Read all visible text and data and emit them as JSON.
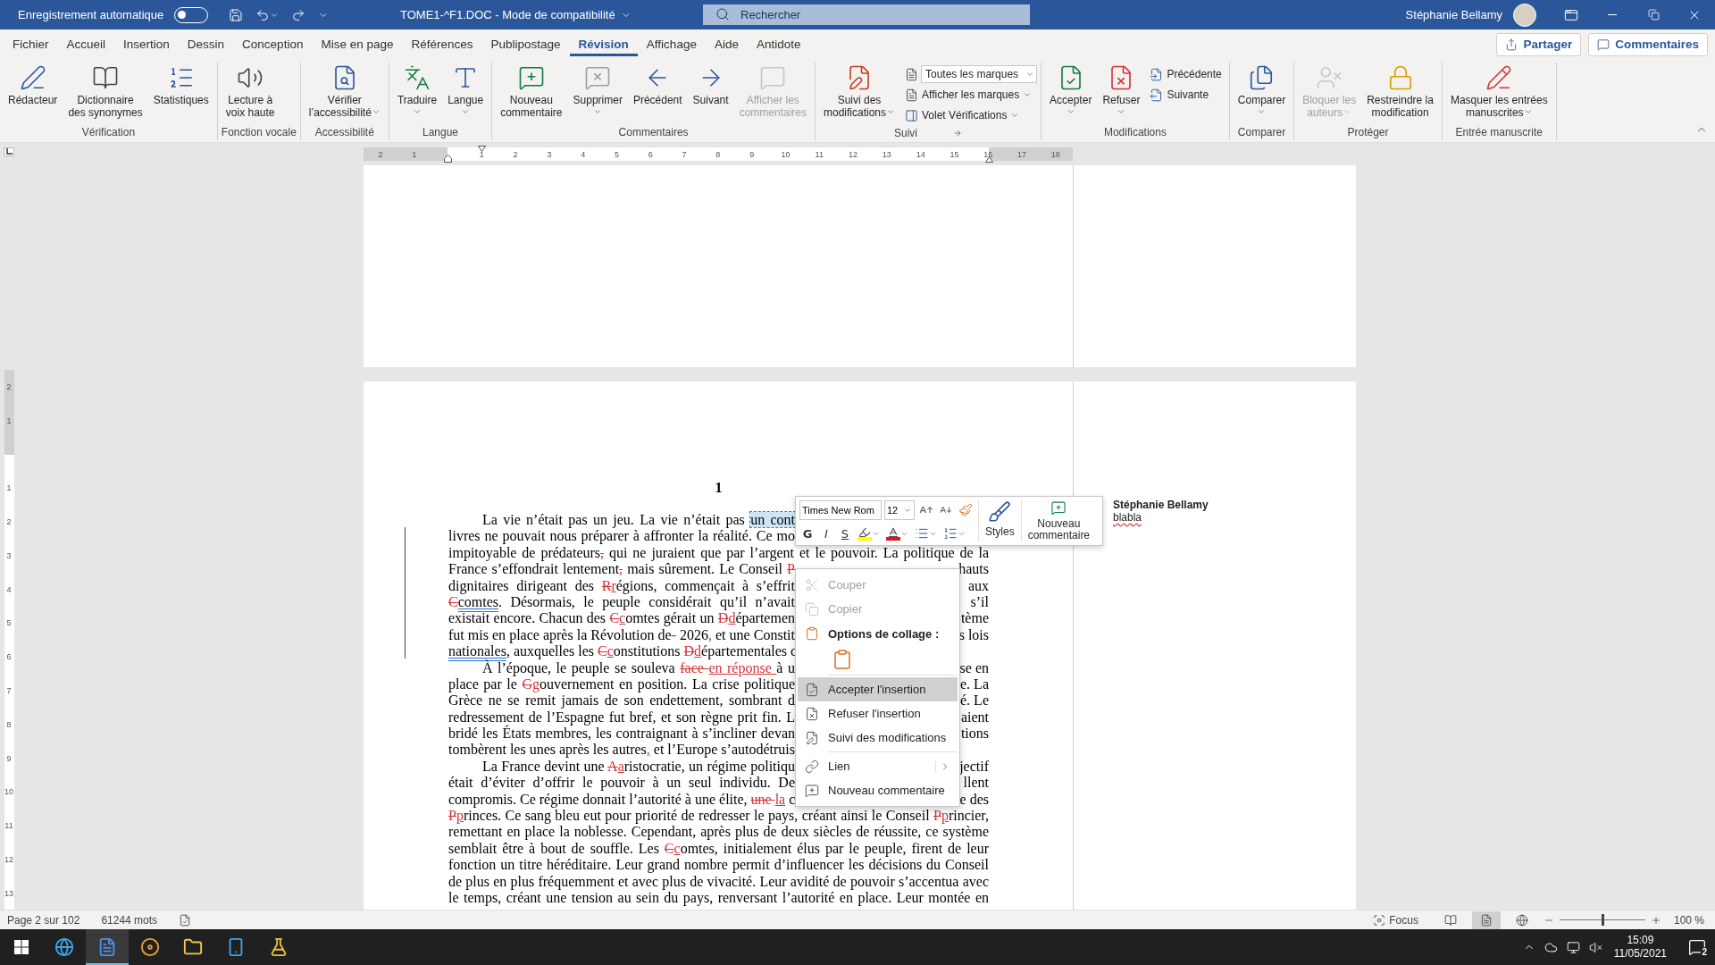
{
  "title_bar": {
    "autosave_label": "Enregistrement automatique",
    "autosave_on": false,
    "title": "TOME1-^F1.DOC - Mode de compatibilité",
    "search_placeholder": "Rechercher",
    "user": "Stéphanie Bellamy"
  },
  "menu_tabs": [
    {
      "label": "Fichier",
      "selected": false
    },
    {
      "label": "Accueil",
      "selected": false
    },
    {
      "label": "Insertion",
      "selected": false
    },
    {
      "label": "Dessin",
      "selected": false
    },
    {
      "label": "Conception",
      "selected": false
    },
    {
      "label": "Mise en page",
      "selected": false
    },
    {
      "label": "Références",
      "selected": false
    },
    {
      "label": "Publipostage",
      "selected": false
    },
    {
      "label": "Révision",
      "selected": true
    },
    {
      "label": "Affichage",
      "selected": false
    },
    {
      "label": "Aide",
      "selected": false
    },
    {
      "label": "Antidote",
      "selected": false
    }
  ],
  "share_button": "Partager",
  "comments_button": "Commentaires",
  "ribbon": [
    {
      "label": "Vérification",
      "items": [
        {
          "kind": "large",
          "label": "Rédacteur",
          "disabled": false
        },
        {
          "kind": "large",
          "label": "Dictionnaire\ndes synonymes",
          "disabled": false
        },
        {
          "kind": "large",
          "label": "Statistiques",
          "disabled": false
        }
      ]
    },
    {
      "label": "Fonction vocale",
      "items": [
        {
          "kind": "large",
          "label": "Lecture à\nvoix haute",
          "disabled": false
        }
      ]
    },
    {
      "label": "Accessibilité",
      "items": [
        {
          "kind": "large",
          "label": "Vérifier\nl’accessibilité",
          "dropdown": true,
          "disabled": false
        }
      ]
    },
    {
      "label": "Langue",
      "items": [
        {
          "kind": "large",
          "label": "Traduire",
          "dropdown": true,
          "disabled": false
        },
        {
          "kind": "large",
          "label": "Langue",
          "dropdown": true,
          "disabled": false
        }
      ]
    },
    {
      "label": "Commentaires",
      "items": [
        {
          "kind": "large",
          "label": "Nouveau\ncommentaire",
          "disabled": false
        },
        {
          "kind": "large",
          "label": "Supprimer",
          "dropdown": true,
          "disabled": false
        },
        {
          "kind": "large",
          "label": "Précédent",
          "disabled": false
        },
        {
          "kind": "large",
          "label": "Suivant",
          "disabled": false
        },
        {
          "kind": "large",
          "label": "Afficher les\ncommentaires",
          "disabled": true
        }
      ]
    },
    {
      "label": "Suivi",
      "launcher": true,
      "items": [
        {
          "kind": "large",
          "label": "Suivi des\nmodifications",
          "dropdown": true,
          "disabled": false
        },
        {
          "kind": "select",
          "label": "Toutes les marques",
          "disabled": false
        },
        {
          "kind": "small",
          "label": "Afficher les marques",
          "dropdown": true,
          "disabled": false
        },
        {
          "kind": "small",
          "label": "Volet Vérifications",
          "dropdown": true,
          "disabled": false
        }
      ]
    },
    {
      "label": "Modifications",
      "items": [
        {
          "kind": "large",
          "label": "Accepter",
          "dropdown": true,
          "disabled": false
        },
        {
          "kind": "large",
          "label": "Refuser",
          "dropdown": true,
          "disabled": false
        },
        {
          "kind": "small",
          "label": "Précédente",
          "disabled": false
        },
        {
          "kind": "small",
          "label": "Suivante",
          "disabled": false
        }
      ]
    },
    {
      "label": "Comparer",
      "items": [
        {
          "kind": "large",
          "label": "Comparer",
          "dropdown": true,
          "disabled": false
        }
      ]
    },
    {
      "label": "Protéger",
      "items": [
        {
          "kind": "large",
          "label": "Bloquer les\nauteurs",
          "dropdown": true,
          "disabled": true
        },
        {
          "kind": "large",
          "label": "Restreindre la\nmodification",
          "disabled": false
        }
      ]
    },
    {
      "label": "Entrée manuscrite",
      "items": [
        {
          "kind": "large",
          "label": "Masquer les entrées\nmanuscrites",
          "dropdown": true,
          "disabled": false
        }
      ]
    }
  ],
  "ruler": {
    "left_labels": [
      "2",
      "1"
    ],
    "right_labels": [
      "1",
      "2",
      "3",
      "4",
      "5",
      "6",
      "7",
      "8",
      "9",
      "10",
      "11",
      "12",
      "13",
      "14",
      "15",
      "16",
      "17",
      "18"
    ]
  },
  "vertical_ruler": {
    "top_labels": [
      "2",
      "1"
    ],
    "labels": [
      "1",
      "2",
      "3",
      "4",
      "5",
      "6",
      "7",
      "8",
      "9",
      "10",
      "11",
      "12",
      "13"
    ]
  },
  "page": {
    "heading": "1",
    "lines": [
      {
        "indent": true,
        "full": false,
        "left": [
          {
            "kind": "plain",
            "text": "La vie n’était pas un jeu. La vie n’était pas "
          },
          {
            "kind": "selected",
            "text": "un cont"
          }
        ]
      },
      {
        "indent": false,
        "full": false,
        "left": [
          {
            "kind": "plain",
            "text": "livres ne pouvait nous préparer à affronter la réalité. Ce mo"
          }
        ]
      },
      {
        "indent": false,
        "full": true,
        "left": [
          {
            "kind": "plain",
            "text": "impitoyable de prédateurs"
          },
          {
            "kind": "deleted",
            "text": ","
          },
          {
            "kind": "plain",
            "text": " qui ne juraient que par l’argent et le pouvoir. La politique de la"
          }
        ]
      },
      {
        "indent": false,
        "full": false,
        "left": [
          {
            "kind": "plain",
            "text": "France s’effondrait lentement"
          },
          {
            "kind": "deleted",
            "text": ","
          },
          {
            "kind": "plain",
            "text": " mais sûrement. Le Conseil "
          },
          {
            "kind": "deleted",
            "text": "P"
          }
        ],
        "right": "hauts"
      },
      {
        "indent": false,
        "full": false,
        "left": [
          {
            "kind": "plain",
            "text": "dignitaires dirigeant des "
          },
          {
            "kind": "deleted",
            "text": "R"
          },
          {
            "kind": "inserted",
            "text": "r"
          },
          {
            "kind": "plain",
            "text": "égions, commençait à s’effrit"
          }
        ],
        "right": "aux"
      },
      {
        "indent": false,
        "full": false,
        "left": [
          {
            "kind": "deleted",
            "text": "C"
          },
          {
            "kind": "grammar",
            "text": "comtes"
          },
          {
            "kind": "plain",
            "text": ". Désormais, le peuple considérait qu’il n’avait"
          }
        ],
        "right": "s’il"
      },
      {
        "indent": false,
        "full": false,
        "left": [
          {
            "kind": "plain",
            "text": "existait encore. Chacun des "
          },
          {
            "kind": "deleted",
            "text": "C"
          },
          {
            "kind": "inserted",
            "text": "c"
          },
          {
            "kind": "plain",
            "text": "omtes gérait un "
          },
          {
            "kind": "deleted",
            "text": "D"
          },
          {
            "kind": "inserted",
            "text": "d"
          },
          {
            "kind": "plain",
            "text": "épartemen"
          }
        ],
        "right": "tème"
      },
      {
        "indent": false,
        "full": false,
        "left": [
          {
            "kind": "plain",
            "text": "fut mis en place après la Révolution de"
          },
          {
            "kind": "deleted",
            "text": "-"
          },
          {
            "kind": "plain",
            "text": " 2026"
          },
          {
            "kind": "inserted",
            "text": ","
          },
          {
            "kind": "plain",
            "text": " et une Constit"
          }
        ],
        "right": "s lois"
      },
      {
        "indent": false,
        "full": false,
        "left": [
          {
            "kind": "grammar",
            "text": "nationales"
          },
          {
            "kind": "plain",
            "text": ", auxquelles les "
          },
          {
            "kind": "deleted",
            "text": "C"
          },
          {
            "kind": "inserted",
            "text": "c"
          },
          {
            "kind": "plain",
            "text": "onstitutions "
          },
          {
            "kind": "deleted",
            "text": "D"
          },
          {
            "kind": "inserted",
            "text": "d"
          },
          {
            "kind": "plain",
            "text": "épartementales c"
          }
        ]
      },
      {
        "indent": true,
        "full": false,
        "left": [
          {
            "kind": "plain",
            "text": "À l’époque, le peuple se souleva "
          },
          {
            "kind": "deleted",
            "text": "face "
          },
          {
            "kind": "inserted",
            "text": "en réponse "
          },
          {
            "kind": "plain",
            "text": "à u"
          }
        ],
        "right": "se en"
      },
      {
        "indent": false,
        "full": false,
        "left": [
          {
            "kind": "plain",
            "text": "place par le "
          },
          {
            "kind": "deleted",
            "text": "G"
          },
          {
            "kind": "inserted",
            "text": "g"
          },
          {
            "kind": "plain",
            "text": "ouvernement en position. La crise politique"
          }
        ],
        "right": "e. La"
      },
      {
        "indent": false,
        "full": false,
        "left": [
          {
            "kind": "plain",
            "text": "Grèce ne se remit jamais de son endettement, sombrant d"
          }
        ],
        "right": "é. Le"
      },
      {
        "indent": false,
        "full": false,
        "left": [
          {
            "kind": "plain",
            "text": "redressement de l’Espagne fut bref, et son règne prit fin. L"
          }
        ],
        "right": "aient"
      },
      {
        "indent": false,
        "full": false,
        "left": [
          {
            "kind": "plain",
            "text": "bridé les États membres, les contraignant à s’incliner devan"
          }
        ],
        "right": "tions"
      },
      {
        "indent": false,
        "full": false,
        "left": [
          {
            "kind": "plain",
            "text": "tombèrent les unes après les autres"
          },
          {
            "kind": "inserted",
            "text": ","
          },
          {
            "kind": "plain",
            "text": " et l’Europe s’autodétruis"
          }
        ]
      },
      {
        "indent": true,
        "full": false,
        "left": [
          {
            "kind": "plain",
            "text": "La France devint une "
          },
          {
            "kind": "deleted",
            "text": "A"
          },
          {
            "kind": "inserted",
            "text": "a"
          },
          {
            "kind": "plain",
            "text": "ristocratie, un régime politiqu"
          }
        ],
        "right": "jectif"
      },
      {
        "indent": false,
        "full": false,
        "left": [
          {
            "kind": "plain",
            "text": "était d’éviter d’offrir le pouvoir à un seul individu. De"
          }
        ],
        "right": "llent"
      },
      {
        "indent": false,
        "full": false,
        "left": [
          {
            "kind": "plain",
            "text": "compromis. Ce régime donnait l’autorité à une élite, "
          },
          {
            "kind": "deleted",
            "text": "une "
          },
          {
            "kind": "inserted",
            "text": "la"
          },
          {
            "kind": "plain",
            "text": " c"
          }
        ],
        "right": "e des"
      },
      {
        "indent": false,
        "full": true,
        "left": [
          {
            "kind": "deleted",
            "text": "P"
          },
          {
            "kind": "inserted",
            "text": "p"
          },
          {
            "kind": "plain",
            "text": "rinces. Ce sang bleu eut pour priorité de redresser le pays, créant ainsi le Conseil "
          },
          {
            "kind": "deleted",
            "text": "P"
          },
          {
            "kind": "inserted",
            "text": "p"
          },
          {
            "kind": "plain",
            "text": "rincier,"
          }
        ]
      },
      {
        "indent": false,
        "full": true,
        "left": [
          {
            "kind": "plain",
            "text": "remettant en place la noblesse. Cependant, après plus de deux siècles de réussite, ce système"
          }
        ]
      },
      {
        "indent": false,
        "full": true,
        "left": [
          {
            "kind": "plain",
            "text": "semblait être à bout de souffle. Les "
          },
          {
            "kind": "deleted",
            "text": "C"
          },
          {
            "kind": "inserted",
            "text": "c"
          },
          {
            "kind": "plain",
            "text": "omtes, initialement élus par le peuple, firent de leur"
          }
        ]
      },
      {
        "indent": false,
        "full": true,
        "left": [
          {
            "kind": "plain",
            "text": "fonction un titre héréditaire. Leur grand nombre permit d’influencer les décisions du Conseil"
          }
        ]
      },
      {
        "indent": false,
        "full": true,
        "left": [
          {
            "kind": "plain",
            "text": "de plus en plus fréquemment et avec plus de vivacité. Leur avidité de pouvoir s’accentua avec"
          }
        ]
      },
      {
        "indent": false,
        "full": true,
        "left": [
          {
            "kind": "plain",
            "text": "le temps, créant une tension au sein du pays, renversant l’autorité en place. Leur montée en"
          }
        ]
      }
    ]
  },
  "comment": {
    "author": "Stéphanie Bellamy",
    "text": "blabla"
  },
  "mini_toolbar": {
    "font": "Times New Rom",
    "size": "12",
    "format_buttons": [
      "G",
      "I",
      "S"
    ],
    "styles_label": "Styles",
    "new_comment_label": "Nouveau\ncommentaire"
  },
  "context_menu": [
    {
      "kind": "item",
      "label": "Couper",
      "disabled": true,
      "selected": false,
      "submenu": false
    },
    {
      "kind": "item",
      "label": "Copier",
      "disabled": true,
      "selected": false,
      "submenu": false
    },
    {
      "kind": "header",
      "label": "Options de collage :"
    },
    {
      "kind": "paste"
    },
    {
      "kind": "separator"
    },
    {
      "kind": "item",
      "label": "Accepter l'insertion",
      "disabled": false,
      "selected": true,
      "submenu": false
    },
    {
      "kind": "item",
      "label": "Refuser l'insertion",
      "disabled": false,
      "selected": false,
      "submenu": false
    },
    {
      "kind": "item",
      "label": "Suivi des modifications",
      "disabled": false,
      "selected": false,
      "submenu": false
    },
    {
      "kind": "separator"
    },
    {
      "kind": "item",
      "label": "Lien",
      "disabled": false,
      "selected": false,
      "submenu": true
    },
    {
      "kind": "item",
      "label": "Nouveau commentaire",
      "disabled": false,
      "selected": false,
      "submenu": false
    }
  ],
  "status_bar": {
    "page": "Page 2 sur 102",
    "words": "61244 mots",
    "focus": "Focus",
    "views": [
      {
        "selected": false
      },
      {
        "selected": true
      },
      {
        "selected": false
      }
    ],
    "zoom": {
      "level": 0.5,
      "reading": "100 %"
    }
  },
  "taskbar": {
    "apps": [
      {
        "selected": false
      },
      {
        "selected": true
      },
      {
        "selected": false
      },
      {
        "selected": false
      },
      {
        "selected": false
      },
      {
        "selected": false
      }
    ],
    "time": "15:09",
    "date": "11/05/2021",
    "notifications": "2"
  }
}
